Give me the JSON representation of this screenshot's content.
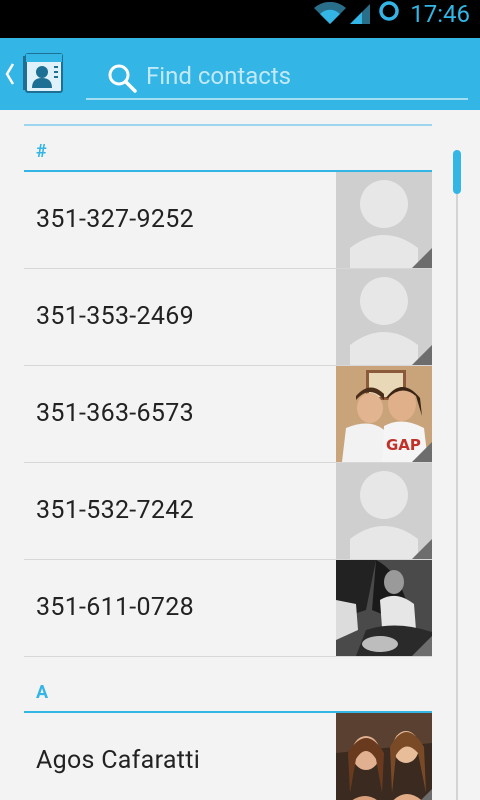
{
  "status_bar": {
    "time": "17:46"
  },
  "search": {
    "placeholder": "Find contacts"
  },
  "sections": [
    {
      "header": "#",
      "contacts": [
        {
          "name": "351-327-9252",
          "photo": "default-avatar"
        },
        {
          "name": "351-353-2469",
          "photo": "default-avatar"
        },
        {
          "name": "351-363-6573",
          "photo": "photo"
        },
        {
          "name": "351-532-7242",
          "photo": "default-avatar"
        },
        {
          "name": "351-611-0728",
          "photo": "photo"
        }
      ]
    },
    {
      "header": "A",
      "contacts": [
        {
          "name": "Agos Cafaratti",
          "photo": "photo"
        }
      ]
    }
  ],
  "colors": {
    "accent": "#33b5e5",
    "status_bar": "#000000"
  }
}
